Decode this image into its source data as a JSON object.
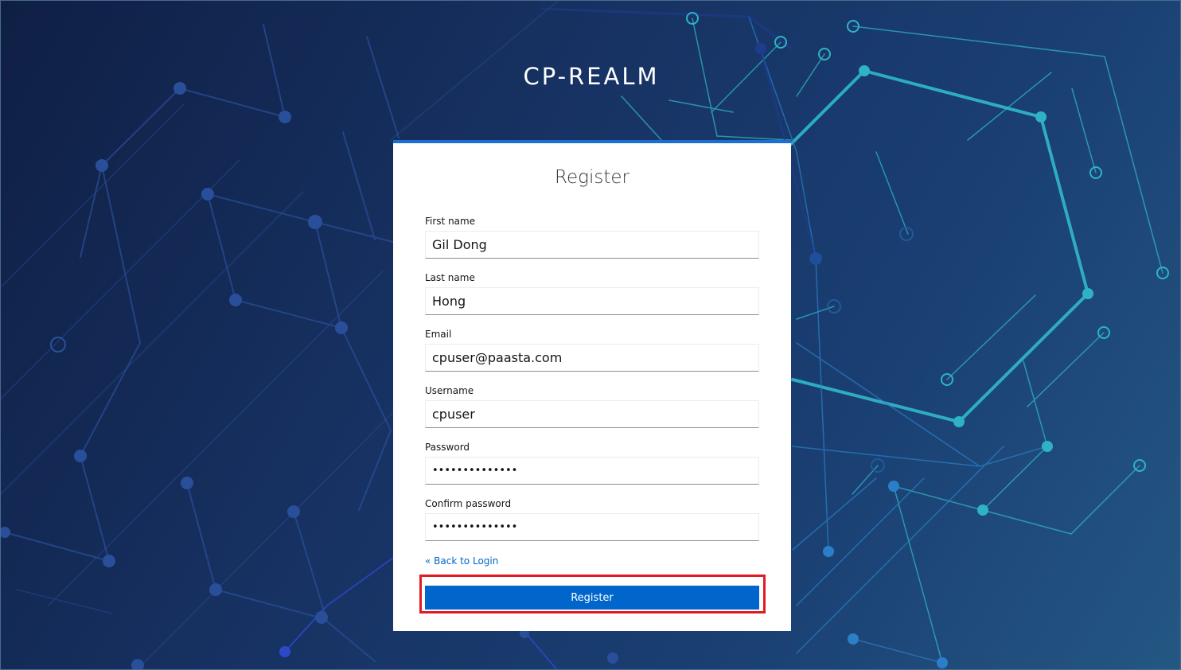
{
  "app": {
    "realm_title": "CP-REALM"
  },
  "form": {
    "title": "Register",
    "fields": [
      {
        "label": "First name",
        "value": "Gil Dong",
        "type": "text"
      },
      {
        "label": "Last name",
        "value": "Hong",
        "type": "text"
      },
      {
        "label": "Email",
        "value": "cpuser@paasta.com",
        "type": "text"
      },
      {
        "label": "Username",
        "value": "cpuser",
        "type": "text"
      },
      {
        "label": "Password",
        "value": "••••••••••••••",
        "type": "password"
      },
      {
        "label": "Confirm password",
        "value": "••••••••••••••",
        "type": "password"
      }
    ],
    "back_link": "« Back to Login",
    "submit_label": "Register"
  },
  "colors": {
    "accent": "#0066cc",
    "card_top_border": "#1c6fd1",
    "highlight": "#e01b24",
    "background_dark": "#0f1f44",
    "background_light": "#245783",
    "circuit_teal": "#2fb3c4",
    "circuit_blue": "#2a5fb8"
  }
}
